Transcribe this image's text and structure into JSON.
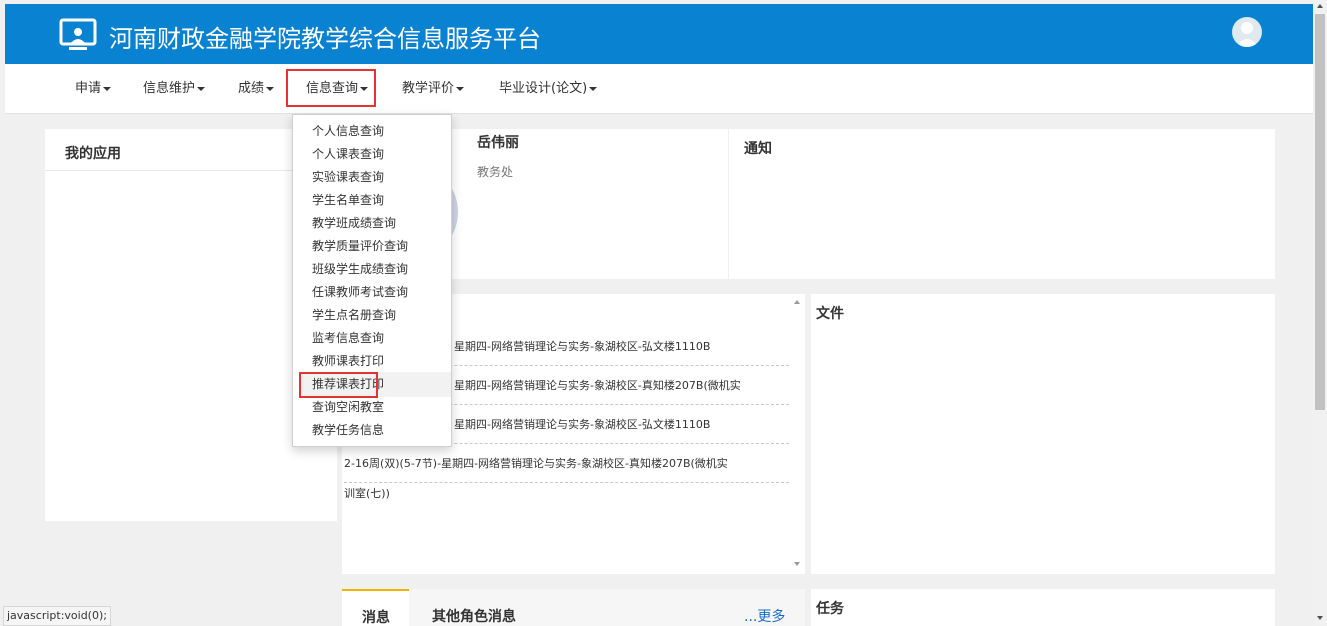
{
  "header": {
    "title": "河南财政金融学院教学综合信息服务平台"
  },
  "nav": {
    "items": [
      {
        "label": "申请"
      },
      {
        "label": "信息维护"
      },
      {
        "label": "成绩"
      },
      {
        "label": "信息查询"
      },
      {
        "label": "教学评价"
      },
      {
        "label": "毕业设计(论文)"
      }
    ]
  },
  "dropdown": {
    "items": [
      "个人信息查询",
      "个人课表查询",
      "实验课表查询",
      "学生名单查询",
      "教学班成绩查询",
      "教学质量评价查询",
      "班级学生成绩查询",
      "任课教师考试查询",
      "学生点名册查询",
      "监考信息查询",
      "教师课表打印",
      "推荐课表打印",
      "查询空闲教室",
      "教学任务信息"
    ]
  },
  "my_apps": {
    "title": "我的应用"
  },
  "profile": {
    "name": "岳伟丽",
    "dept": "教务处"
  },
  "notice": {
    "title": "通知"
  },
  "schedule": {
    "rows": [
      "星期四-网络营销理论与实务-象湖校区-弘文楼1110B",
      "星期四-网络营销理论与实务-象湖校区-真知楼207B(微机实",
      "星期四-网络营销理论与实务-象湖校区-弘文楼1110B",
      "2-16周(双)(5-7节)-星期四-网络营销理论与实务-象湖校区-真知楼207B(微机实",
      "训室(七))"
    ]
  },
  "files": {
    "title": "文件"
  },
  "messages": {
    "tab_active": "消息",
    "tab_other": "其他角色消息",
    "more": "...更多"
  },
  "tasks": {
    "title": "任务"
  },
  "status_bar": {
    "text": "javascript:void(0);"
  }
}
